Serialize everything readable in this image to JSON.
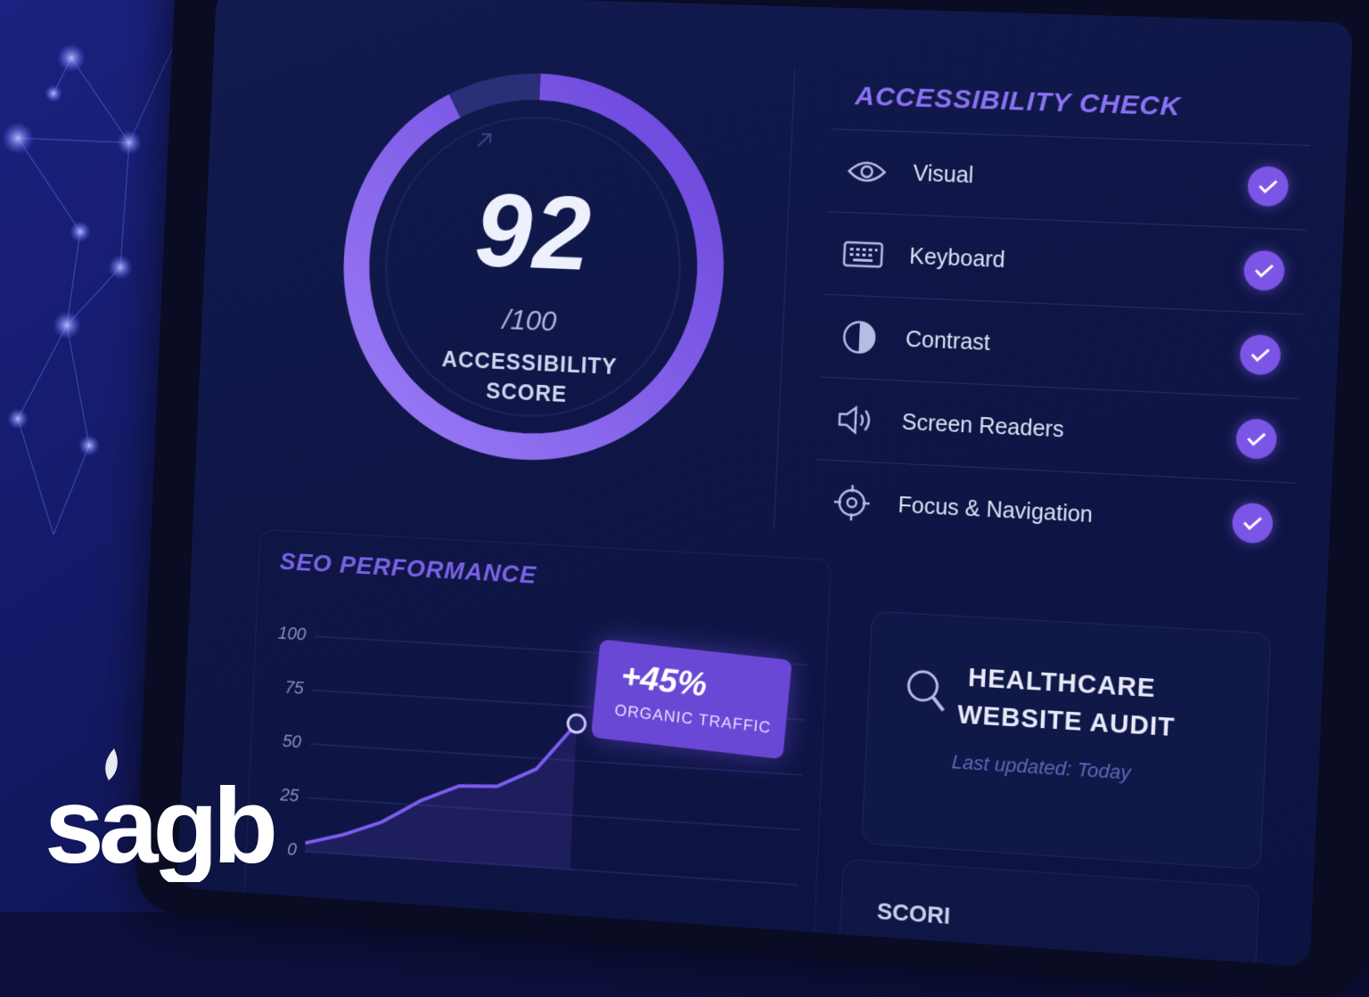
{
  "score": {
    "value": "92",
    "max": "/100",
    "label": "ACCESSIBILITY SCORE",
    "percent": 92
  },
  "accessibility_check": {
    "title": "ACCESSIBILITY CHECK",
    "items": [
      {
        "label": "Visual",
        "icon": "eye-icon",
        "passed": true
      },
      {
        "label": "Keyboard",
        "icon": "keyboard-icon",
        "passed": true
      },
      {
        "label": "Contrast",
        "icon": "contrast-icon",
        "passed": true
      },
      {
        "label": "Screen Readers",
        "icon": "speaker-icon",
        "passed": true
      },
      {
        "label": "Focus & Navigation",
        "icon": "crosshair-icon",
        "passed": true
      }
    ]
  },
  "seo": {
    "title": "SEO PERFORMANCE",
    "y_ticks": [
      "100",
      "75",
      "50",
      "25",
      "0"
    ],
    "callout": {
      "value": "+45%",
      "label": "ORGANIC TRAFFIC"
    }
  },
  "chart_data": {
    "type": "line",
    "title": "SEO PERFORMANCE",
    "xlabel": "",
    "ylabel": "",
    "ylim": [
      0,
      100
    ],
    "x": [
      1,
      2,
      3,
      4,
      5,
      6,
      7,
      8
    ],
    "series": [
      {
        "values": [
          4,
          9,
          16,
          27,
          35,
          36,
          45,
          67
        ]
      }
    ],
    "annotation": {
      "text": "+45% ORGANIC TRAFFIC",
      "at_x": 8
    }
  },
  "audit": {
    "title_line1": "HEALTHCARE",
    "title_line2": "WEBSITE AUDIT",
    "updated": "Last updated: Today",
    "icon": "search-icon"
  },
  "bottom_card": {
    "partial_title": "SCORI"
  },
  "logo": {
    "text": "sagb"
  },
  "colors": {
    "accent": "#7a55e6",
    "background": "#0b0f3a",
    "panel": "#121a4f"
  }
}
